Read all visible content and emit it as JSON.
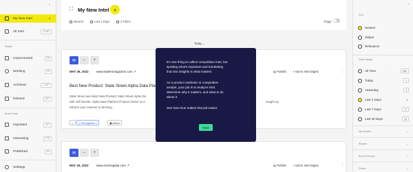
{
  "left_sidebar": {
    "items_top": [
      {
        "label": "My New Intel",
        "count": "4"
      },
      {
        "label": "All Intel",
        "count": "3,187"
      }
    ],
    "states_heading": "States",
    "states": [
      {
        "label": "Unprocessed",
        "count": "20"
      },
      {
        "label": "Working",
        "count": "23"
      },
      {
        "label": "Archived",
        "count": "2,427"
      },
      {
        "label": "Deleted",
        "count": "427"
      }
    ],
    "board_heading": "Board Data",
    "board": [
      {
        "label": "Important",
        "count": "117"
      },
      {
        "label": "Interesting",
        "count": "176"
      },
      {
        "label": "Published",
        "count": "54"
      }
    ],
    "settings_label": "Settings"
  },
  "header": {
    "title": "My New Intel",
    "badge": "4",
    "filters": [
      "Newest",
      "Last 2 Days",
      "2 Filters"
    ],
    "triage_label": "Triage"
  },
  "divider_label": "Today",
  "cards": [
    {
      "date": "MAY 26, 2022",
      "source": "www.tradersmagazine.com",
      "publish": "Publish",
      "add_digest": "Add to Intel Digest",
      "title": "Best New Product: State Street Alpha Data Platf",
      "body": [
        "State Street won Best New Product! State Street Alpha Da",
        "with Jeff Shortle, Alpha Data Platform Product Owner at S",
        "What is your reaction to winning..."
      ],
      "body_right": "caught up",
      "tags": [
        "Recognition",
        "Article"
      ]
    },
    {
      "date": "MAY 25, 2022",
      "source": "www.morningstar.com",
      "publish": "Publish",
      "add_digest": "Add to Intel Digest"
    }
  ],
  "modal": {
    "para1": [
      "It's one thing to collect competitive intel, but",
      "spotting what's important and translating",
      "that into insights is what matters."
    ],
    "para2": [
      "As a product marketer or competitive",
      "analyst, your job is to analyze intel,",
      "determine why it matters, and what to do",
      "about it."
    ],
    "para3": [
      "See how Klue makes that job easier."
    ],
    "next_label": "Next"
  },
  "right_panel": {
    "sort_heading": "Sort",
    "sort": [
      {
        "label": "Newest",
        "selected": true
      },
      {
        "label": "Oldest",
        "selected": false
      },
      {
        "label": "Relevance",
        "selected": false
      }
    ],
    "date_heading": "Date Range",
    "dates": [
      {
        "label": "All Time",
        "count": "580",
        "selected": false
      },
      {
        "label": "Today",
        "count": "1",
        "selected": false
      },
      {
        "label": "Yesterday",
        "count": "3",
        "selected": false
      },
      {
        "label": "Last 2 Days",
        "count": "4",
        "selected": true
      },
      {
        "label": "Last 7 Days",
        "count": "17",
        "selected": false
      },
      {
        "label": "Last 30 Days",
        "count": "43",
        "selected": false
      }
    ],
    "sections": [
      "My Boards",
      "Boards",
      "Board Groups",
      "States"
    ]
  },
  "colors": {
    "accent_yellow": "#f2e90c",
    "modal_bg": "#1a1946",
    "next_green": "#3ddc97",
    "action_blue": "#3b5bdb"
  }
}
